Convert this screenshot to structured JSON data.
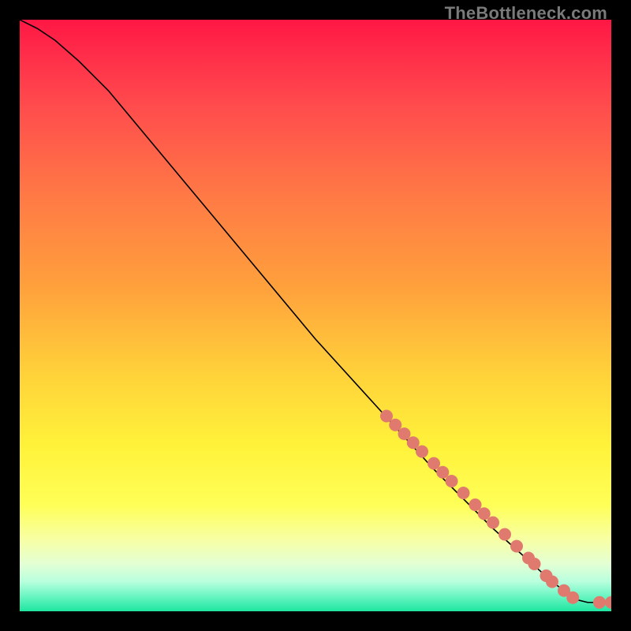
{
  "watermark": "TheBottleneck.com",
  "chart_data": {
    "type": "line",
    "title": "",
    "xlabel": "",
    "ylabel": "",
    "xlim": [
      0,
      100
    ],
    "ylim": [
      0,
      100
    ],
    "grid": false,
    "series": [
      {
        "name": "curve",
        "kind": "line",
        "color": "#000000",
        "x": [
          0,
          3,
          6,
          10,
          15,
          20,
          30,
          40,
          50,
          60,
          70,
          80,
          90,
          94,
          96,
          98,
          100
        ],
        "y": [
          100,
          98.5,
          96.5,
          93,
          88,
          82,
          70,
          58,
          46,
          35,
          24,
          14,
          5,
          2,
          1.5,
          1.5,
          1.5
        ]
      },
      {
        "name": "markers",
        "kind": "scatter",
        "color": "#e07a6f",
        "points": [
          {
            "x": 62,
            "y": 33
          },
          {
            "x": 63.5,
            "y": 31.5
          },
          {
            "x": 65,
            "y": 30
          },
          {
            "x": 66.5,
            "y": 28.5
          },
          {
            "x": 68,
            "y": 27
          },
          {
            "x": 70,
            "y": 25
          },
          {
            "x": 71.5,
            "y": 23.5
          },
          {
            "x": 73,
            "y": 22
          },
          {
            "x": 75,
            "y": 20
          },
          {
            "x": 77,
            "y": 18
          },
          {
            "x": 78.5,
            "y": 16.5
          },
          {
            "x": 80,
            "y": 15
          },
          {
            "x": 82,
            "y": 13
          },
          {
            "x": 84,
            "y": 11
          },
          {
            "x": 86,
            "y": 9
          },
          {
            "x": 87,
            "y": 8
          },
          {
            "x": 89,
            "y": 6
          },
          {
            "x": 90,
            "y": 5
          },
          {
            "x": 92,
            "y": 3.5
          },
          {
            "x": 93.5,
            "y": 2.3
          },
          {
            "x": 98,
            "y": 1.5
          },
          {
            "x": 100,
            "y": 1.5
          }
        ]
      }
    ],
    "background_gradient": {
      "type": "vertical",
      "stops": [
        {
          "pos": 0.0,
          "color": "#ff1744"
        },
        {
          "pos": 0.05,
          "color": "#ff2a49"
        },
        {
          "pos": 0.15,
          "color": "#ff4d4d"
        },
        {
          "pos": 0.3,
          "color": "#ff7a45"
        },
        {
          "pos": 0.45,
          "color": "#ffa03c"
        },
        {
          "pos": 0.6,
          "color": "#ffd23a"
        },
        {
          "pos": 0.72,
          "color": "#fff23a"
        },
        {
          "pos": 0.82,
          "color": "#ffff57"
        },
        {
          "pos": 0.88,
          "color": "#f7ffa6"
        },
        {
          "pos": 0.92,
          "color": "#e3ffd4"
        },
        {
          "pos": 0.95,
          "color": "#b8ffde"
        },
        {
          "pos": 0.975,
          "color": "#68f5c2"
        },
        {
          "pos": 1.0,
          "color": "#1ee6a0"
        }
      ]
    }
  }
}
